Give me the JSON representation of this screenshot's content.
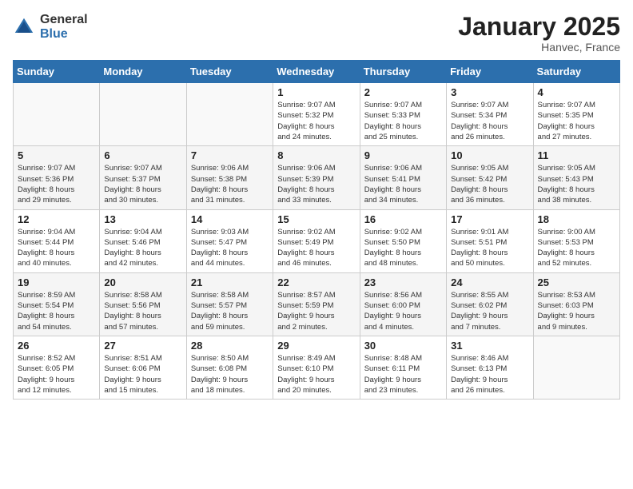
{
  "logo": {
    "general": "General",
    "blue": "Blue"
  },
  "title": "January 2025",
  "subtitle": "Hanvec, France",
  "days_of_week": [
    "Sunday",
    "Monday",
    "Tuesday",
    "Wednesday",
    "Thursday",
    "Friday",
    "Saturday"
  ],
  "weeks": [
    [
      {
        "day": "",
        "info": ""
      },
      {
        "day": "",
        "info": ""
      },
      {
        "day": "",
        "info": ""
      },
      {
        "day": "1",
        "info": "Sunrise: 9:07 AM\nSunset: 5:32 PM\nDaylight: 8 hours\nand 24 minutes."
      },
      {
        "day": "2",
        "info": "Sunrise: 9:07 AM\nSunset: 5:33 PM\nDaylight: 8 hours\nand 25 minutes."
      },
      {
        "day": "3",
        "info": "Sunrise: 9:07 AM\nSunset: 5:34 PM\nDaylight: 8 hours\nand 26 minutes."
      },
      {
        "day": "4",
        "info": "Sunrise: 9:07 AM\nSunset: 5:35 PM\nDaylight: 8 hours\nand 27 minutes."
      }
    ],
    [
      {
        "day": "5",
        "info": "Sunrise: 9:07 AM\nSunset: 5:36 PM\nDaylight: 8 hours\nand 29 minutes."
      },
      {
        "day": "6",
        "info": "Sunrise: 9:07 AM\nSunset: 5:37 PM\nDaylight: 8 hours\nand 30 minutes."
      },
      {
        "day": "7",
        "info": "Sunrise: 9:06 AM\nSunset: 5:38 PM\nDaylight: 8 hours\nand 31 minutes."
      },
      {
        "day": "8",
        "info": "Sunrise: 9:06 AM\nSunset: 5:39 PM\nDaylight: 8 hours\nand 33 minutes."
      },
      {
        "day": "9",
        "info": "Sunrise: 9:06 AM\nSunset: 5:41 PM\nDaylight: 8 hours\nand 34 minutes."
      },
      {
        "day": "10",
        "info": "Sunrise: 9:05 AM\nSunset: 5:42 PM\nDaylight: 8 hours\nand 36 minutes."
      },
      {
        "day": "11",
        "info": "Sunrise: 9:05 AM\nSunset: 5:43 PM\nDaylight: 8 hours\nand 38 minutes."
      }
    ],
    [
      {
        "day": "12",
        "info": "Sunrise: 9:04 AM\nSunset: 5:44 PM\nDaylight: 8 hours\nand 40 minutes."
      },
      {
        "day": "13",
        "info": "Sunrise: 9:04 AM\nSunset: 5:46 PM\nDaylight: 8 hours\nand 42 minutes."
      },
      {
        "day": "14",
        "info": "Sunrise: 9:03 AM\nSunset: 5:47 PM\nDaylight: 8 hours\nand 44 minutes."
      },
      {
        "day": "15",
        "info": "Sunrise: 9:02 AM\nSunset: 5:49 PM\nDaylight: 8 hours\nand 46 minutes."
      },
      {
        "day": "16",
        "info": "Sunrise: 9:02 AM\nSunset: 5:50 PM\nDaylight: 8 hours\nand 48 minutes."
      },
      {
        "day": "17",
        "info": "Sunrise: 9:01 AM\nSunset: 5:51 PM\nDaylight: 8 hours\nand 50 minutes."
      },
      {
        "day": "18",
        "info": "Sunrise: 9:00 AM\nSunset: 5:53 PM\nDaylight: 8 hours\nand 52 minutes."
      }
    ],
    [
      {
        "day": "19",
        "info": "Sunrise: 8:59 AM\nSunset: 5:54 PM\nDaylight: 8 hours\nand 54 minutes."
      },
      {
        "day": "20",
        "info": "Sunrise: 8:58 AM\nSunset: 5:56 PM\nDaylight: 8 hours\nand 57 minutes."
      },
      {
        "day": "21",
        "info": "Sunrise: 8:58 AM\nSunset: 5:57 PM\nDaylight: 8 hours\nand 59 minutes."
      },
      {
        "day": "22",
        "info": "Sunrise: 8:57 AM\nSunset: 5:59 PM\nDaylight: 9 hours\nand 2 minutes."
      },
      {
        "day": "23",
        "info": "Sunrise: 8:56 AM\nSunset: 6:00 PM\nDaylight: 9 hours\nand 4 minutes."
      },
      {
        "day": "24",
        "info": "Sunrise: 8:55 AM\nSunset: 6:02 PM\nDaylight: 9 hours\nand 7 minutes."
      },
      {
        "day": "25",
        "info": "Sunrise: 8:53 AM\nSunset: 6:03 PM\nDaylight: 9 hours\nand 9 minutes."
      }
    ],
    [
      {
        "day": "26",
        "info": "Sunrise: 8:52 AM\nSunset: 6:05 PM\nDaylight: 9 hours\nand 12 minutes."
      },
      {
        "day": "27",
        "info": "Sunrise: 8:51 AM\nSunset: 6:06 PM\nDaylight: 9 hours\nand 15 minutes."
      },
      {
        "day": "28",
        "info": "Sunrise: 8:50 AM\nSunset: 6:08 PM\nDaylight: 9 hours\nand 18 minutes."
      },
      {
        "day": "29",
        "info": "Sunrise: 8:49 AM\nSunset: 6:10 PM\nDaylight: 9 hours\nand 20 minutes."
      },
      {
        "day": "30",
        "info": "Sunrise: 8:48 AM\nSunset: 6:11 PM\nDaylight: 9 hours\nand 23 minutes."
      },
      {
        "day": "31",
        "info": "Sunrise: 8:46 AM\nSunset: 6:13 PM\nDaylight: 9 hours\nand 26 minutes."
      },
      {
        "day": "",
        "info": ""
      }
    ]
  ]
}
